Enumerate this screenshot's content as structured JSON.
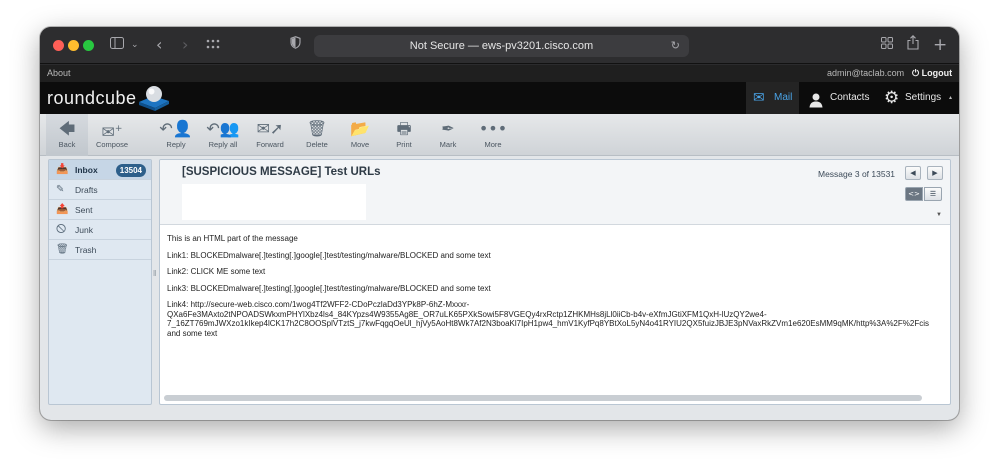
{
  "browser": {
    "address": "Not Secure — ews-pv3201.cisco.com",
    "colors": {
      "close": "#fe5f57",
      "minimize": "#febc2e",
      "zoom": "#28c840"
    }
  },
  "topbar": {
    "about": "About",
    "user": "admin@taclab.com",
    "logout": "Logout"
  },
  "header": {
    "logo": "roundcube",
    "nav": [
      {
        "label": "Mail",
        "icon": "mail-icon"
      },
      {
        "label": "Contacts",
        "icon": "contacts-icon"
      },
      {
        "label": "Settings",
        "icon": "gear-icon"
      }
    ],
    "accent": "#4aa4e8"
  },
  "toolbar": {
    "back": "Back",
    "compose": "Compose",
    "reply": "Reply",
    "reply_all": "Reply all",
    "forward": "Forward",
    "delete": "Delete",
    "move": "Move",
    "print": "Print",
    "mark": "Mark",
    "more": "More"
  },
  "folders": [
    {
      "name": "Inbox",
      "icon": "inbox-icon",
      "unread": "13504"
    },
    {
      "name": "Drafts",
      "icon": "pencil-icon"
    },
    {
      "name": "Sent",
      "icon": "sent-icon"
    },
    {
      "name": "Junk",
      "icon": "junk-icon"
    },
    {
      "name": "Trash",
      "icon": "trash-icon"
    }
  ],
  "message": {
    "subject": "[SUSPICIOUS MESSAGE] Test URLs",
    "position": "Message 3 of 13531",
    "body": {
      "intro": "This is an HTML part of the message",
      "link1": "Link1: BLOCKEDmalware[.]testing[.]google[.]test/testing/malware/BLOCKED and some text",
      "link2": "Link2: CLICK ME some text",
      "link3": "Link3: BLOCKEDmalware[.]testing[.]google[.]test/testing/malware/BLOCKED and some text",
      "link4_line1": "Link4: http://secure-web.cisco.com/1wog4Tf2WFF2-CDoPczlaDd3YPk8P-6hZ-Mxxxr-",
      "link4_line2": "QXa6Fe3MAxto2tNPOADSWkxmPHYlXbz4ls4_84KYpzs4W9355Ag8E_OR7uLK65PXkSowi5F8VGEQy4rxRctp1ZHKMHs8jLl0iiCb-b4v-eXfmJGtiXFM1QxH-lUzQY2we4-",
      "link4_line3": "7_16ZT769mJWXzo1kIkep4lCK17h2C8OOSplVTztS_j7kwFqgqOeUl_hjVy5AoHt8Wk7Af2N3boaKl7IpH1pw4_hmV1KyfPq8YBtXoL5yN4o41RYIU2QX5fuizJBJE3pNVaxRkZVm1e620EsMM9qMK/http%3A%2F%2Fcis",
      "link4_line4": "and some text"
    }
  }
}
